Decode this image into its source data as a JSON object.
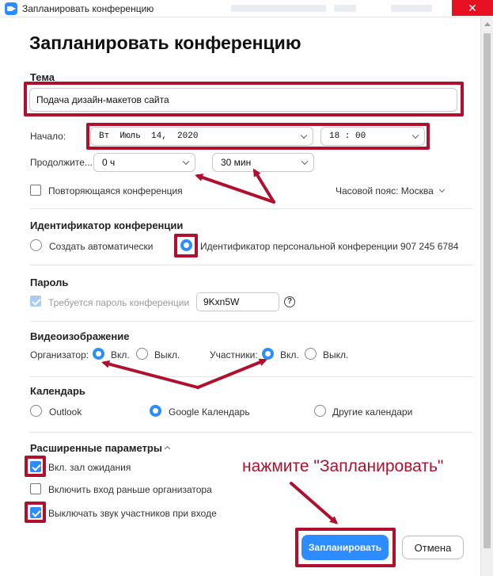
{
  "window": {
    "title": "Запланировать конференцию",
    "icon": "zoom-app-icon",
    "close_glyph": "✕"
  },
  "heading": "Запланировать конференцию",
  "topic": {
    "label": "Тема",
    "value": "Подача дизайн-макетов сайта"
  },
  "start": {
    "label": "Начало:",
    "date": "Вт  Июль  14,  2020",
    "time": "18 : 00"
  },
  "duration": {
    "label": "Продолжите...",
    "hours": "0 ч",
    "minutes": "30 мин"
  },
  "recurring": {
    "label": "Повторяющаяся конференция",
    "checked": false
  },
  "timezone": {
    "label": "Часовой пояс: Москва"
  },
  "meeting_id": {
    "title": "Идентификатор конференции",
    "option_auto": "Создать автоматически",
    "option_personal": "Идентификатор персональной конференции 907 245 6784",
    "selected": "personal"
  },
  "password": {
    "title": "Пароль",
    "require_label": "Требуется пароль конференции",
    "value": "9Kxn5W",
    "help_glyph": "?"
  },
  "video": {
    "title": "Видеоизображение",
    "host_label": "Организатор:",
    "participants_label": "Участники:",
    "on_label": "Вкл.",
    "off_label": "Выкл.",
    "host": "on",
    "participants": "on"
  },
  "calendar": {
    "title": "Календарь",
    "options": [
      "Outlook",
      "Google Календарь",
      "Другие календари"
    ],
    "selected": "Google Календарь"
  },
  "advanced": {
    "title": "Расширенные параметры",
    "options": [
      {
        "label": "Вкл. зал ожидания",
        "checked": true
      },
      {
        "label": "Включить вход раньше организатора",
        "checked": false
      },
      {
        "label": "Выключать звук участников при входе",
        "checked": true
      }
    ]
  },
  "annotation": "нажмите \"Запланировать\"",
  "buttons": {
    "schedule": "Запланировать",
    "cancel": "Отмена"
  },
  "colors": {
    "accent": "#2d8cff",
    "highlight": "#b0102e",
    "close": "#e81123"
  }
}
